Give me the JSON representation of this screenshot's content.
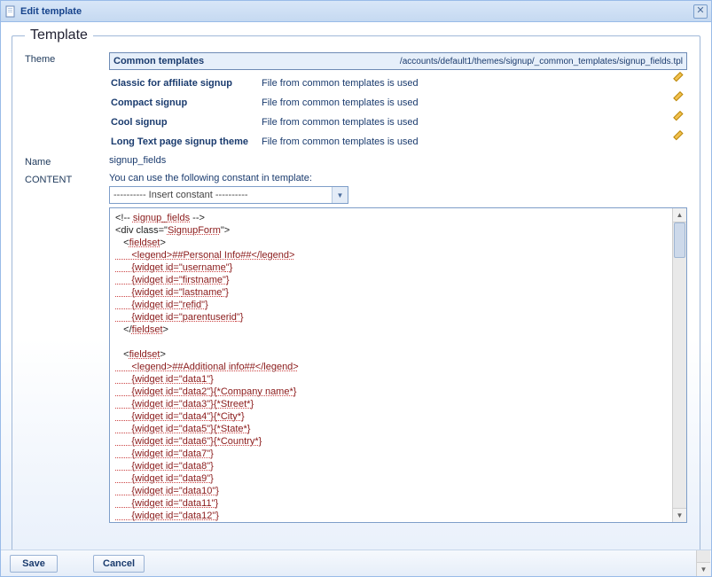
{
  "window": {
    "title": "Edit template",
    "close_label": "✕"
  },
  "fieldset": {
    "legend": "Template"
  },
  "labels": {
    "theme": "Theme",
    "name": "Name",
    "content": "CONTENT"
  },
  "theme_selected": {
    "name": "Common templates",
    "path": "/accounts/default1/themes/signup/_common_templates/signup_fields.tpl"
  },
  "themes": [
    {
      "name": "Classic for affiliate signup",
      "file": "File from common templates is used"
    },
    {
      "name": "Compact signup",
      "file": "File from common templates is used"
    },
    {
      "name": "Cool signup",
      "file": "File from common templates is used"
    },
    {
      "name": "Long Text page signup theme",
      "file": "File from common templates is used"
    }
  ],
  "name_value": "signup_fields",
  "content": {
    "hint": "You can use the following constant in template:",
    "select_label": "----------  Insert constant  ----------"
  },
  "code_plain_prefix": "<!-- ",
  "code_plain_suffix": " -->",
  "code": {
    "l1": "signup_fields",
    "l2a": "<div class=\"",
    "l2b": "SignupForm",
    "l2c": "\">",
    "l3a": "   <",
    "l3b": "fieldset",
    "l3c": ">",
    "l4a": "      <legend>##Personal Info##</legend>",
    "l5a": "      {widget id=\"",
    "l5b": "username",
    "l5c": "\"}",
    "l6b": "firstname",
    "l7b": "lastname",
    "l8b": "refid",
    "l9b": "parentuserid",
    "l10a": "   </",
    "l10b": "fieldset",
    "l10c": ">",
    "blank": "",
    "l12a": "   <",
    "l12b": "fieldset",
    "l12c": ">",
    "l13": "      <legend>##Additional info##</legend>",
    "l14": "      {widget id=\"data1\"}",
    "l15": "      {widget id=\"data2\"}{*Company name*}",
    "l16": "      {widget id=\"data3\"}{*Street*}",
    "l17": "      {widget id=\"data4\"}{*City*}",
    "l18": "      {widget id=\"data5\"}{*State*}",
    "l19": "      {widget id=\"data6\"}{*Country*}",
    "l20": "      {widget id=\"data7\"}",
    "l21": "      {widget id=\"data8\"}",
    "l22": "      {widget id=\"data9\"}",
    "l23": "      {widget id=\"data10\"}",
    "l24": "      {widget id=\"data11\"}",
    "l25": "      {widget id=\"data12\"}"
  },
  "buttons": {
    "save": "Save",
    "cancel": "Cancel"
  }
}
